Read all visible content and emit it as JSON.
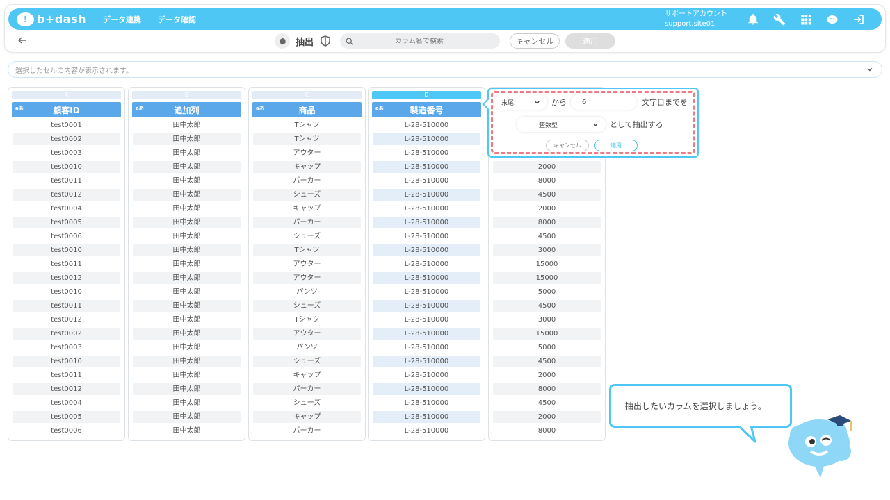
{
  "header": {
    "logo_text": "b+dash",
    "nav": [
      "データ連携",
      "データ確認"
    ],
    "account_name": "サポートアカウント",
    "account_id": "support.site01"
  },
  "toolbar": {
    "extract_label": "抽出",
    "search_placeholder": "カラム名で検索",
    "cancel_label": "キャンセル",
    "apply_label": "適用"
  },
  "cellbar": {
    "placeholder": "選択したセルの内容が表示されます。"
  },
  "columns": [
    {
      "letter": "A",
      "type": "aあ",
      "name": "顧客ID",
      "cells": [
        "test0001",
        "test0002",
        "test0003",
        "test0010",
        "test0011",
        "test0012",
        "test0004",
        "test0005",
        "test0006",
        "test0010",
        "test0011",
        "test0012",
        "test0010",
        "test0011",
        "test0012",
        "test0002",
        "test0003",
        "test0010",
        "test0011",
        "test0012",
        "test0004",
        "test0005",
        "test0006"
      ]
    },
    {
      "letter": "B",
      "type": "aあ",
      "name": "追加列",
      "cells": [
        "田中太郎",
        "田中太郎",
        "田中太郎",
        "田中太郎",
        "田中太郎",
        "田中太郎",
        "田中太郎",
        "田中太郎",
        "田中太郎",
        "田中太郎",
        "田中太郎",
        "田中太郎",
        "田中太郎",
        "田中太郎",
        "田中太郎",
        "田中太郎",
        "田中太郎",
        "田中太郎",
        "田中太郎",
        "田中太郎",
        "田中太郎",
        "田中太郎",
        "田中太郎"
      ]
    },
    {
      "letter": "C",
      "type": "aあ",
      "name": "商品",
      "cells": [
        "Tシャツ",
        "Tシャツ",
        "アウター",
        "キャップ",
        "パーカー",
        "シューズ",
        "キャップ",
        "パーカー",
        "シューズ",
        "Tシャツ",
        "アウター",
        "アウター",
        "パンツ",
        "シューズ",
        "Tシャツ",
        "アウター",
        "パンツ",
        "シューズ",
        "キャップ",
        "パーカー",
        "シューズ",
        "キャップ",
        "パーカー"
      ]
    },
    {
      "letter": "D",
      "type": "aあ",
      "name": "製造番号",
      "cells": [
        "L-28-510000",
        "L-28-510000",
        "L-28-510000",
        "L-28-510000",
        "L-28-510000",
        "L-28-510000",
        "L-28-510000",
        "L-28-510000",
        "L-28-510000",
        "L-28-510000",
        "L-28-510000",
        "L-28-510000",
        "L-28-510000",
        "L-28-510000",
        "L-28-510000",
        "L-28-510000",
        "L-28-510000",
        "L-28-510000",
        "L-28-510000",
        "L-28-510000",
        "L-28-510000",
        "L-28-510000",
        "L-28-510000"
      ]
    },
    {
      "letter": "",
      "type": "",
      "name": "",
      "cells": [
        "",
        "",
        "",
        "2000",
        "8000",
        "4500",
        "2000",
        "8000",
        "4500",
        "3000",
        "15000",
        "15000",
        "5000",
        "4500",
        "3000",
        "15000",
        "5000",
        "4500",
        "2000",
        "8000",
        "4500",
        "2000",
        "8000"
      ]
    }
  ],
  "popup": {
    "position_select": "末尾",
    "from_label": "から",
    "count_value": "6",
    "until_label": "文字目までを",
    "type_select": "整数型",
    "extract_as_label": "として抽出する",
    "cancel_label": "キャンセル",
    "apply_label": "適用"
  },
  "hint": {
    "text": "抽出したいカラムを選択しましょう。"
  },
  "colors": {
    "accent": "#4ec7f4",
    "header_blue": "#5aa8ea",
    "dash_red": "#ee7a84"
  }
}
